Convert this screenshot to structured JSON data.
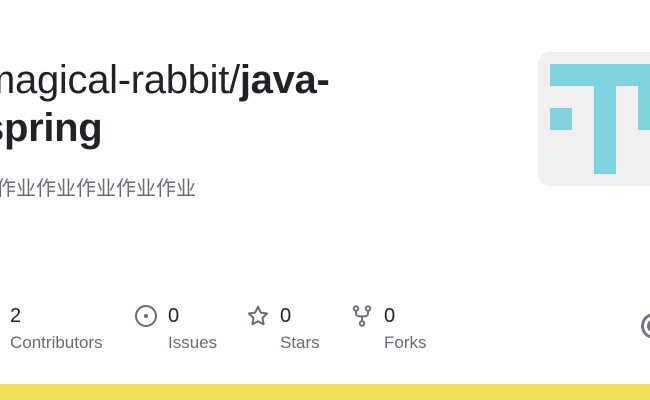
{
  "repo": {
    "owner": "magical-rabbit/",
    "name_line1": "java-",
    "name_line2": "spring",
    "description": "作业作业作业作业作业"
  },
  "stats": {
    "contributors": {
      "count": "2",
      "label": "Contributors",
      "icon": "contributors"
    },
    "issues": {
      "count": "0",
      "label": "Issues",
      "icon": "issue-opened-icon"
    },
    "stars": {
      "count": "0",
      "label": "Stars",
      "icon": "star-icon"
    },
    "forks": {
      "count": "0",
      "label": "Forks",
      "icon": "repo-forked-icon"
    }
  },
  "colors": {
    "language_bar": "#f1e05a",
    "avatar_fill": "#7fd3de",
    "avatar_bg": "#f0f0f0",
    "muted_text": "#656d76",
    "title_text": "#1f2328"
  }
}
